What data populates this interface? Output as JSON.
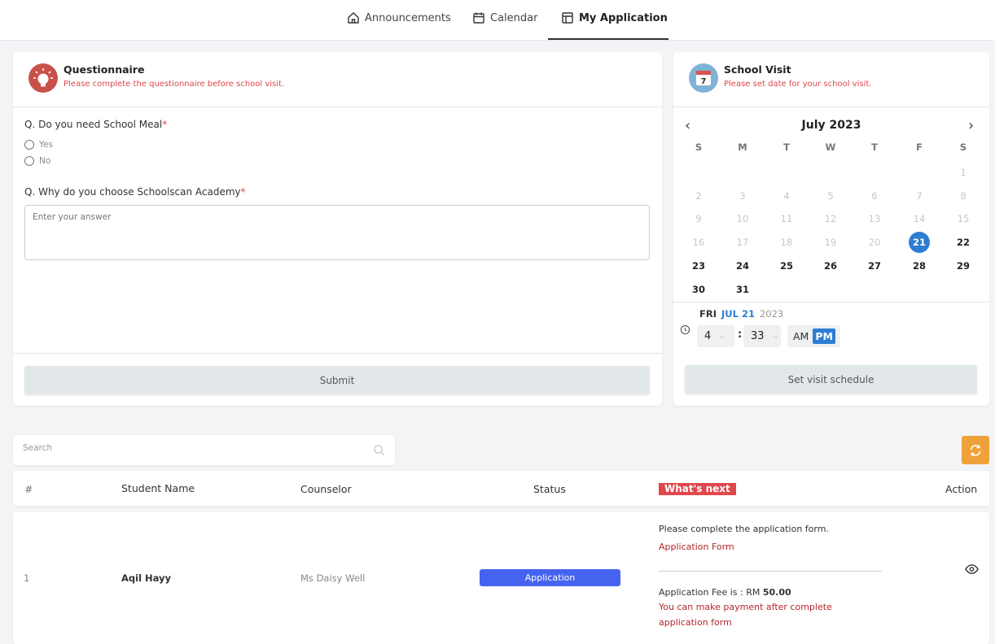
{
  "nav": {
    "tabs": [
      {
        "label": "Announcements",
        "icon": "home-icon"
      },
      {
        "label": "Calendar",
        "icon": "calendar-icon"
      },
      {
        "label": "My Application",
        "icon": "layout-icon"
      }
    ],
    "active_tab": "My Application"
  },
  "questionnaire": {
    "title": "Questionnaire",
    "subtitle": "Please complete the questionnaire before school visit.",
    "q1": {
      "label": "Q. Do you need School Meal",
      "required_mark": "*",
      "options": [
        "Yes",
        "No"
      ]
    },
    "q2": {
      "label": "Q. Why do you choose Schoolscan Academy",
      "required_mark": "*",
      "placeholder": "Enter your answer",
      "value": ""
    },
    "submit_label": "Submit"
  },
  "visit": {
    "title": "School Visit",
    "subtitle": "Please set date for your school visit.",
    "icon_day": "7",
    "month_label": "July 2023",
    "weekdays": [
      "S",
      "M",
      "T",
      "W",
      "T",
      "F",
      "S"
    ],
    "selected_day": 21,
    "selected": {
      "weekday": "FRI",
      "monthday": "JUL 21",
      "year": "2023"
    },
    "time": {
      "hour": "4",
      "minute": "33",
      "separator": ":",
      "am_label": "AM",
      "pm_label": "PM",
      "period": "PM"
    },
    "button_label": "Set visit schedule"
  },
  "search": {
    "placeholder": "Search",
    "value": ""
  },
  "table": {
    "headers": {
      "num": "#",
      "name": "Student Name",
      "counselor": "Counselor",
      "status": "Status",
      "next": "What's next",
      "action": "Action"
    },
    "rows": [
      {
        "num": "1",
        "name": "Aqil Hayy",
        "counselor": "Ms Daisy Well",
        "status": "Application",
        "next_text": "Please complete the application form.",
        "next_link": "Application Form",
        "fee_label": "Application Fee is : RM",
        "fee_amount": "50.00",
        "payment_note_1": "You can make payment after complete",
        "payment_note_2": "application form"
      }
    ]
  },
  "colors": {
    "accent_blue": "#2d7dd2",
    "status_blue": "#4663f0",
    "danger_red": "#e0474c",
    "link_red": "#b3262b",
    "refresh_orange": "#f0a23a"
  }
}
